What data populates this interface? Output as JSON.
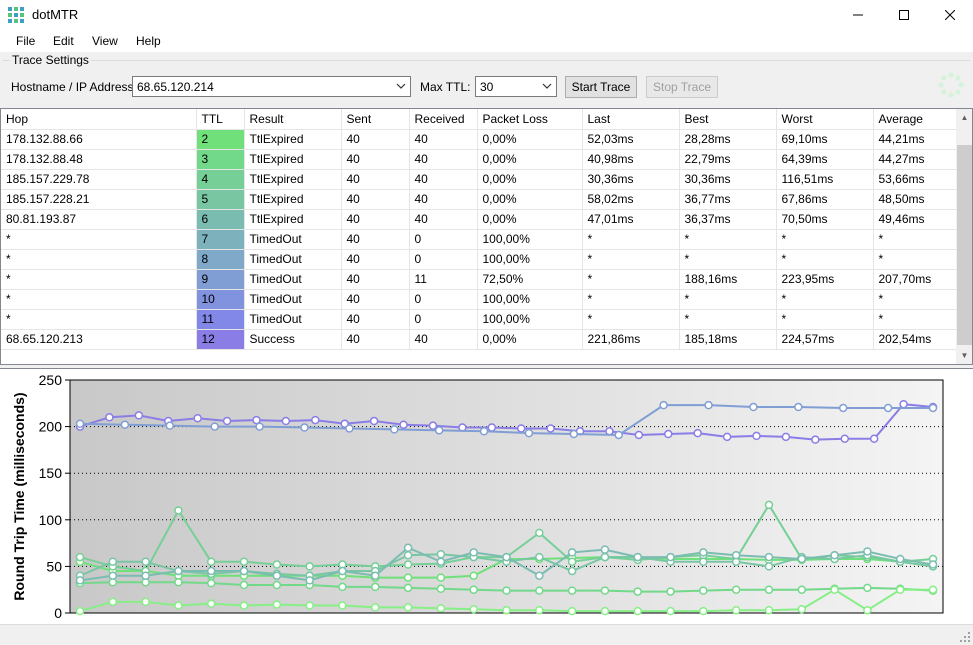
{
  "window": {
    "title": "dotMTR"
  },
  "menu": [
    "File",
    "Edit",
    "View",
    "Help"
  ],
  "settings": {
    "group_title": "Trace Settings",
    "hostname_label": "Hostname / IP Address:",
    "hostname_value": "68.65.120.214",
    "maxttl_label": "Max TTL:",
    "maxttl_value": "30",
    "start_label": "Start Trace",
    "stop_label": "Stop Trace"
  },
  "table": {
    "columns": [
      "Hop",
      "TTL",
      "Result",
      "Sent",
      "Received",
      "Packet Loss",
      "Last",
      "Best",
      "Worst",
      "Average"
    ],
    "rows": [
      {
        "hop": "178.132.88.66",
        "ttl": "2",
        "result": "TtlExpired",
        "sent": "40",
        "received": "40",
        "loss": "0,00%",
        "last": "52,03ms",
        "best": "28,28ms",
        "worst": "69,10ms",
        "avg": "44,21ms",
        "color": "#6fe07a"
      },
      {
        "hop": "178.132.88.48",
        "ttl": "3",
        "result": "TtlExpired",
        "sent": "40",
        "received": "40",
        "loss": "0,00%",
        "last": "40,98ms",
        "best": "22,79ms",
        "worst": "64,39ms",
        "avg": "44,27ms",
        "color": "#72d88a"
      },
      {
        "hop": "185.157.229.78",
        "ttl": "4",
        "result": "TtlExpired",
        "sent": "40",
        "received": "40",
        "loss": "0,00%",
        "last": "30,36ms",
        "best": "30,36ms",
        "worst": "116,51ms",
        "avg": "53,66ms",
        "color": "#76cf96"
      },
      {
        "hop": "185.157.228.21",
        "ttl": "5",
        "result": "TtlExpired",
        "sent": "40",
        "received": "40",
        "loss": "0,00%",
        "last": "58,02ms",
        "best": "36,77ms",
        "worst": "67,86ms",
        "avg": "48,50ms",
        "color": "#79c6a3"
      },
      {
        "hop": "80.81.193.87",
        "ttl": "6",
        "result": "TtlExpired",
        "sent": "40",
        "received": "40",
        "loss": "0,00%",
        "last": "47,01ms",
        "best": "36,37ms",
        "worst": "70,50ms",
        "avg": "49,46ms",
        "color": "#7bbcb1"
      },
      {
        "hop": "*",
        "ttl": "7",
        "result": "TimedOut",
        "sent": "40",
        "received": "0",
        "loss": "100,00%",
        "last": "*",
        "best": "*",
        "worst": "*",
        "avg": "*",
        "color": "#7db2bd"
      },
      {
        "hop": "*",
        "ttl": "8",
        "result": "TimedOut",
        "sent": "40",
        "received": "0",
        "loss": "100,00%",
        "last": "*",
        "best": "*",
        "worst": "*",
        "avg": "*",
        "color": "#7fa8c9"
      },
      {
        "hop": "*",
        "ttl": "9",
        "result": "TimedOut",
        "sent": "40",
        "received": "11",
        "loss": "72,50%",
        "last": "*",
        "best": "188,16ms",
        "worst": "223,95ms",
        "avg": "207,70ms",
        "color": "#809ed4"
      },
      {
        "hop": "*",
        "ttl": "10",
        "result": "TimedOut",
        "sent": "40",
        "received": "0",
        "loss": "100,00%",
        "last": "*",
        "best": "*",
        "worst": "*",
        "avg": "*",
        "color": "#8193df"
      },
      {
        "hop": "*",
        "ttl": "11",
        "result": "TimedOut",
        "sent": "40",
        "received": "0",
        "loss": "100,00%",
        "last": "*",
        "best": "*",
        "worst": "*",
        "avg": "*",
        "color": "#8188e8"
      },
      {
        "hop": "68.65.120.213",
        "ttl": "12",
        "result": "Success",
        "sent": "40",
        "received": "40",
        "loss": "0,00%",
        "last": "221,86ms",
        "best": "185,18ms",
        "worst": "224,57ms",
        "avg": "202,54ms",
        "color": "#8a7de6"
      }
    ]
  },
  "chart_data": {
    "type": "line",
    "ylabel": "Round Trip Time (milliseconds)",
    "ylim": [
      0,
      250
    ],
    "yticks": [
      0,
      50,
      100,
      150,
      200,
      250
    ],
    "grid": true,
    "x": [
      1,
      2,
      3,
      4,
      5,
      6,
      7,
      8,
      9,
      10,
      11,
      12,
      13,
      14,
      15,
      16,
      17,
      18,
      19,
      20,
      21,
      22,
      23,
      24,
      25,
      26,
      27,
      28,
      29
    ],
    "series": [
      {
        "color": "#8a7de6",
        "values": [
          200,
          210,
          212,
          206,
          209,
          206,
          207,
          206,
          207,
          203,
          206,
          202,
          201,
          199,
          199,
          198,
          198,
          195,
          195,
          191,
          192,
          193,
          189,
          190,
          189,
          186,
          187,
          187,
          224,
          221
        ]
      },
      {
        "color": "#809ed4",
        "values": [
          203,
          202,
          201,
          200,
          200,
          199,
          198,
          197,
          196,
          195,
          193,
          192,
          191,
          223,
          223,
          221,
          221,
          220,
          220,
          220
        ]
      },
      {
        "color": "#6fe07a",
        "values": [
          55,
          45,
          45,
          40,
          40,
          40,
          40,
          40,
          40,
          38,
          38,
          38,
          40,
          58,
          58,
          59,
          60,
          60,
          58,
          58,
          58,
          57,
          57,
          58,
          58,
          55,
          50
        ]
      },
      {
        "color": "#72d88a",
        "values": [
          32,
          33,
          33,
          33,
          32,
          30,
          30,
          30,
          28,
          28,
          27,
          26,
          25,
          24,
          24,
          24,
          24,
          23,
          23,
          24,
          25,
          25,
          25,
          26,
          27,
          26,
          24
        ]
      },
      {
        "color": "#76cf96",
        "values": [
          60,
          50,
          45,
          110,
          55,
          55,
          52,
          50,
          52,
          50,
          52,
          53,
          60,
          60,
          86,
          55,
          60,
          57,
          60,
          62,
          58,
          116,
          58,
          62,
          60,
          55,
          58
        ]
      },
      {
        "color": "#79c6a3",
        "values": [
          40,
          55,
          55,
          45,
          42,
          45,
          42,
          40,
          45,
          45,
          62,
          63,
          60,
          55,
          60,
          45,
          60,
          60,
          55,
          55,
          55,
          50,
          60,
          58,
          62,
          55,
          50
        ]
      },
      {
        "color": "#7bbcb1",
        "values": [
          35,
          40,
          40,
          45,
          45,
          45,
          40,
          35,
          45,
          40,
          70,
          55,
          65,
          60,
          40,
          65,
          68,
          60,
          60,
          65,
          62,
          60,
          58,
          62,
          66,
          58,
          52
        ]
      },
      {
        "color": "#86ef86",
        "values": [
          2,
          12,
          12,
          8,
          10,
          8,
          9,
          8,
          8,
          6,
          6,
          5,
          4,
          3,
          3,
          2,
          2,
          2,
          2,
          2,
          3,
          3,
          4,
          25,
          3,
          25,
          25
        ]
      }
    ]
  }
}
